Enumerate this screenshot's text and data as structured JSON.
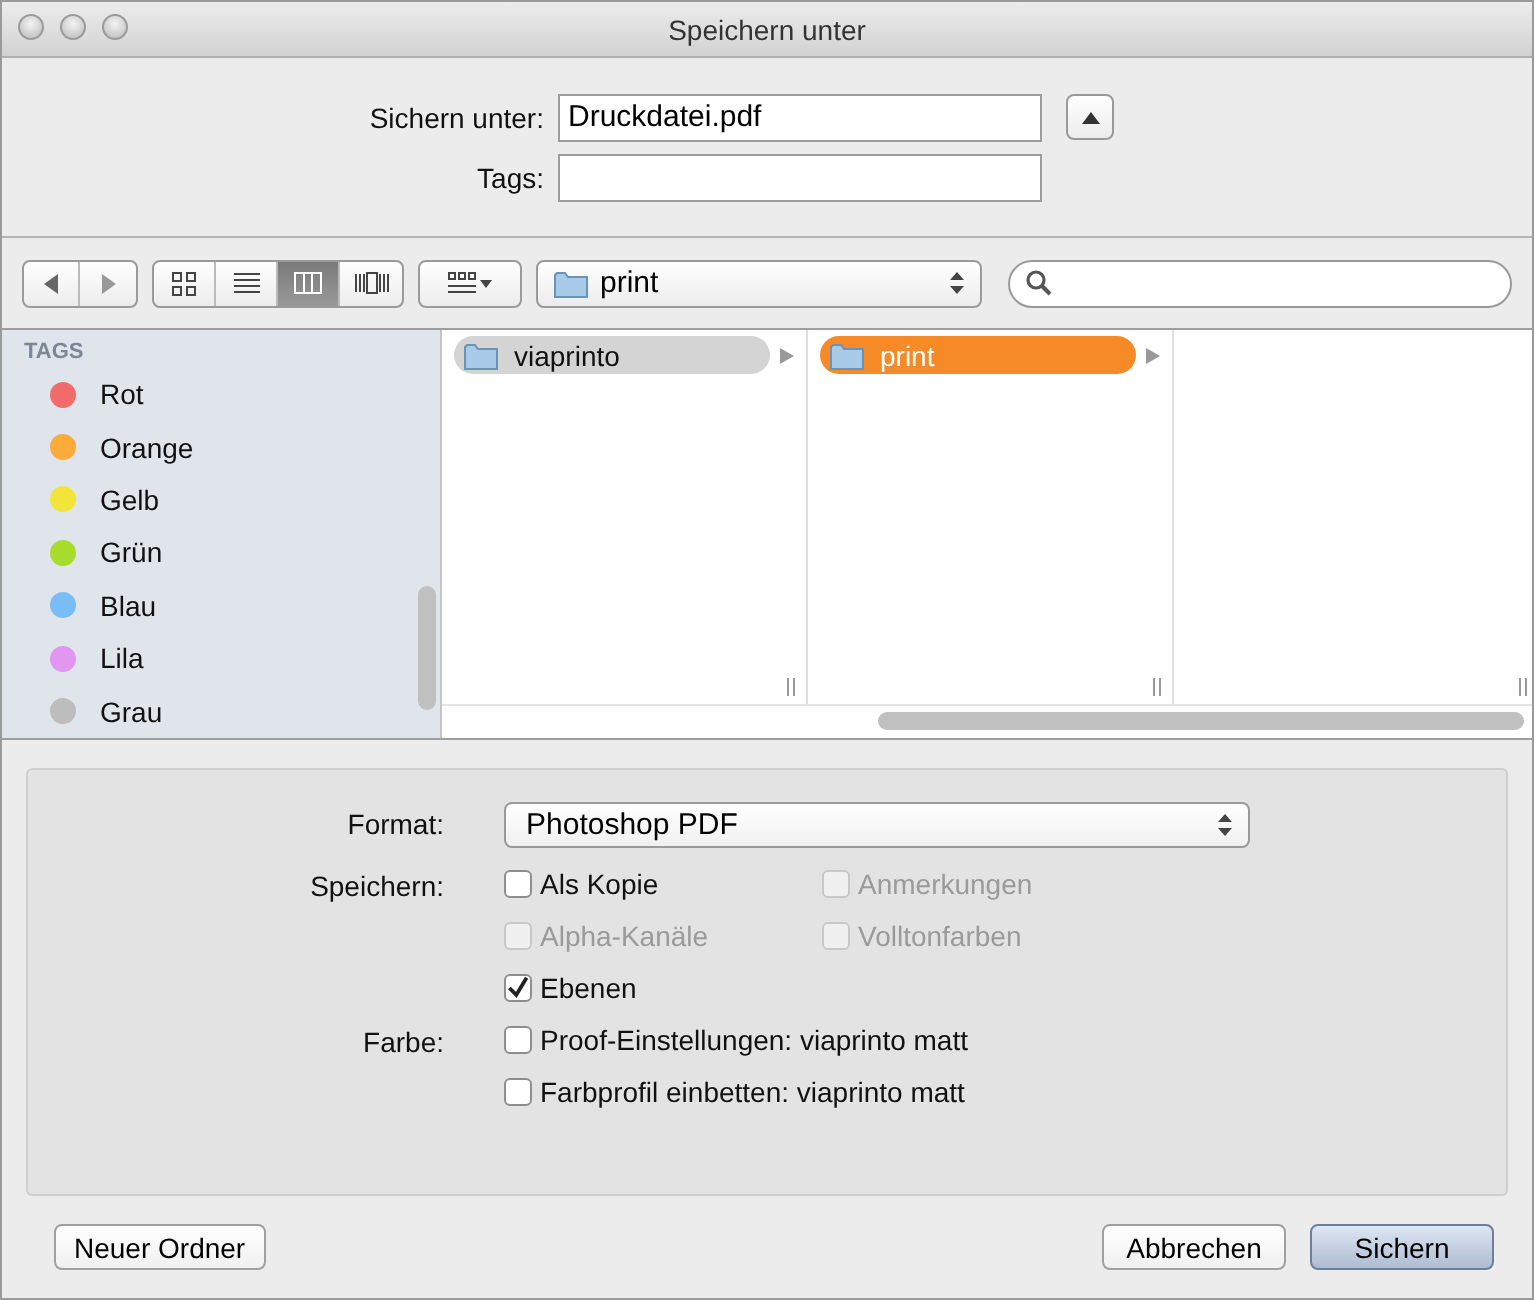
{
  "window": {
    "title": "Speichern unter"
  },
  "save_as": {
    "label": "Sichern unter:",
    "value": "Druckdatei.pdf"
  },
  "tags_field": {
    "label": "Tags:"
  },
  "toolbar": {
    "view_modes": [
      {
        "kind": "icons",
        "selected": false
      },
      {
        "kind": "list",
        "selected": false
      },
      {
        "kind": "columns",
        "selected": true
      },
      {
        "kind": "coverflow",
        "selected": false
      }
    ],
    "location": {
      "label": "print"
    }
  },
  "sidebar": {
    "heading": "TAGS",
    "items": [
      {
        "label": "Rot",
        "color": "#f26b6b"
      },
      {
        "label": "Orange",
        "color": "#fbab3a"
      },
      {
        "label": "Gelb",
        "color": "#f3e43b"
      },
      {
        "label": "Grün",
        "color": "#a8dc2c"
      },
      {
        "label": "Blau",
        "color": "#79bdf6"
      },
      {
        "label": "Lila",
        "color": "#e196f0"
      },
      {
        "label": "Grau",
        "color": "#bdbdbd"
      }
    ]
  },
  "browser": {
    "columns": [
      {
        "items": [
          {
            "label": "viaprinto",
            "selected": true,
            "focused": false
          }
        ]
      },
      {
        "items": [
          {
            "label": "print",
            "selected": true,
            "focused": true
          }
        ]
      },
      {}
    ]
  },
  "options": {
    "format": {
      "label": "Format:",
      "value": "Photoshop PDF"
    },
    "groups": [
      {
        "label": "Speichern:",
        "kind": "grid",
        "checkboxes": [
          {
            "label": "Als Kopie",
            "checked": false,
            "disabled": false
          },
          {
            "label": "Anmerkungen",
            "checked": false,
            "disabled": true
          },
          {
            "label": "Alpha-Kanäle",
            "checked": false,
            "disabled": true
          },
          {
            "label": "Volltonfarben",
            "checked": false,
            "disabled": true
          },
          {
            "label": "Ebenen",
            "checked": true,
            "disabled": false
          }
        ]
      },
      {
        "label": "Farbe:",
        "kind": "list",
        "checkboxes": [
          {
            "label": "Proof-Einstellungen: viaprinto matt",
            "checked": false,
            "disabled": false
          },
          {
            "label": "Farbprofil einbetten: viaprinto matt",
            "checked": false,
            "disabled": false
          }
        ]
      }
    ]
  },
  "buttons_left": [
    {
      "label": "Neuer Ordner",
      "default": false
    }
  ],
  "buttons_right": [
    {
      "label": "Abbrechen",
      "default": false
    },
    {
      "label": "Sichern",
      "default": true
    }
  ]
}
